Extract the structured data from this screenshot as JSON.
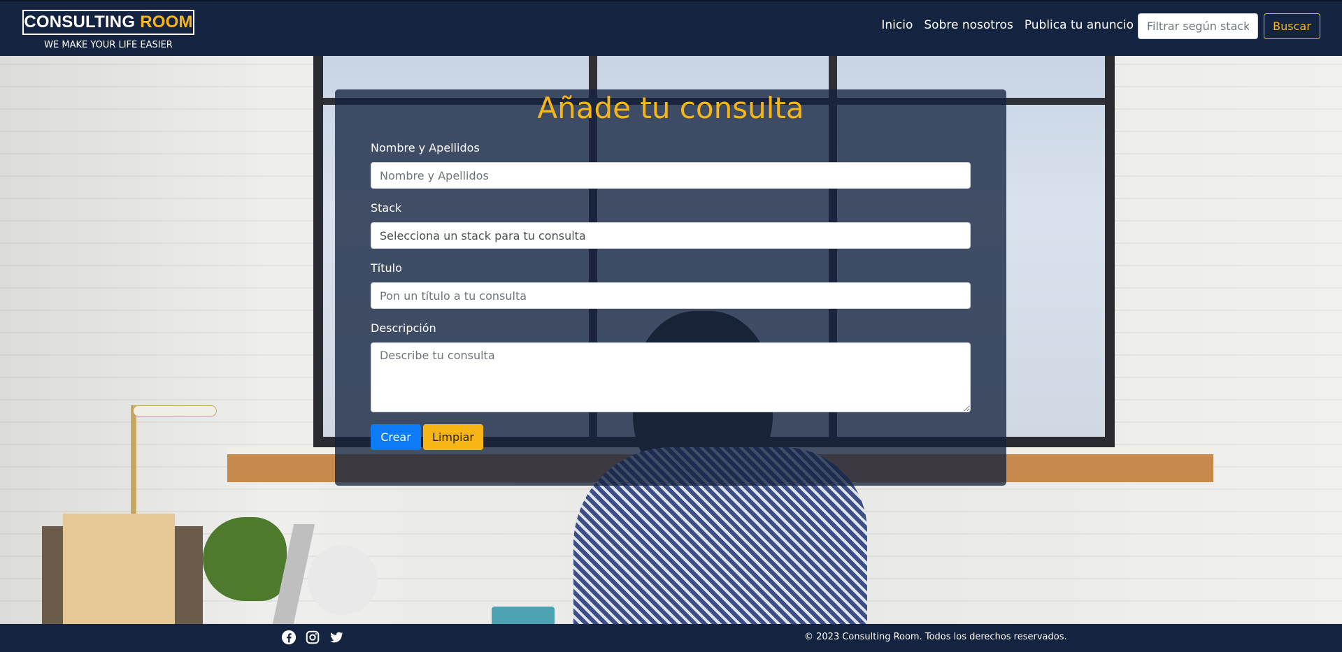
{
  "navbar": {
    "brand_part1": "CONSULTING",
    "brand_part2": "ROOM",
    "tagline": "WE MAKE YOUR LIFE EASIER",
    "links": [
      "Inicio",
      "Sobre nosotros",
      "Publica tu anuncio"
    ],
    "search_placeholder": "Filtrar según stack",
    "search_button": "Buscar"
  },
  "form": {
    "title": "Añade tu consulta",
    "name_label": "Nombre y Apellidos",
    "name_placeholder": "Nombre y Apellidos",
    "stack_label": "Stack",
    "stack_selected": "Selecciona un stack para tu consulta",
    "title_label": "Título",
    "title_placeholder": "Pon un título a tu consulta",
    "description_label": "Descripción",
    "description_placeholder": "Describe tu consulta",
    "create_button": "Crear",
    "clear_button": "Limpiar"
  },
  "footer": {
    "social_icons": [
      "facebook-icon",
      "instagram-icon",
      "twitter-icon"
    ],
    "copyright": "© 2023 Consulting Room. Todos los derechos reservados."
  },
  "colors": {
    "navy": "#14233f",
    "accent_yellow": "#f7b516",
    "primary_blue": "#0d7bf5"
  }
}
